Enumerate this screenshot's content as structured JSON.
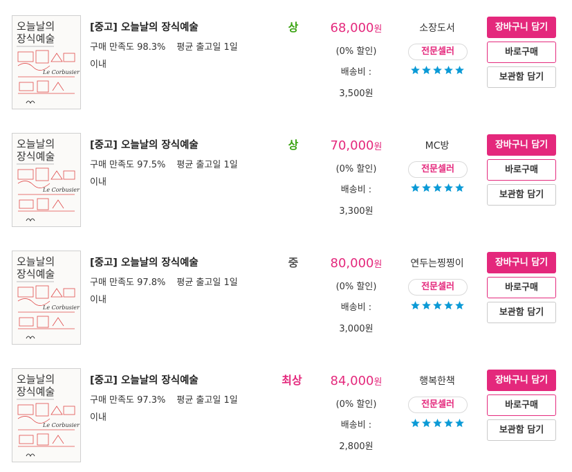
{
  "colors": {
    "accent": "#e4287c",
    "grade_good": "#3aa312",
    "grade_mid": "#555555",
    "grade_best": "#e4287c",
    "star": "#0b9ad6"
  },
  "listings": [
    {
      "title": "[중고] 오늘날의 장식예술",
      "satisfaction_label": "구매 만족도 98.3%",
      "ship_days_label": "평균 출고일 1일",
      "ship_days_suffix": "이내",
      "grade": "상",
      "grade_color": "#3aa312",
      "price": "68,000",
      "currency": "원",
      "discount": "(0% 할인)",
      "shipping_label": "배송비 :",
      "shipping_fee": "3,500원",
      "seller": "소장도서",
      "seller_badge": "전문셀러",
      "rating_stars": 5,
      "cart_button": "장바구니 담기",
      "buy_button": "바로구매",
      "save_button": "보관함 담기"
    },
    {
      "title": "[중고] 오늘날의 장식예술",
      "satisfaction_label": "구매 만족도 97.5%",
      "ship_days_label": "평균 출고일 1일",
      "ship_days_suffix": "이내",
      "grade": "상",
      "grade_color": "#3aa312",
      "price": "70,000",
      "currency": "원",
      "discount": "(0% 할인)",
      "shipping_label": "배송비 :",
      "shipping_fee": "3,300원",
      "seller": "MC방",
      "seller_badge": "전문셀러",
      "rating_stars": 5,
      "cart_button": "장바구니 담기",
      "buy_button": "바로구매",
      "save_button": "보관함 담기"
    },
    {
      "title": "[중고] 오늘날의 장식예술",
      "satisfaction_label": "구매 만족도 97.8%",
      "ship_days_label": "평균 출고일 1일",
      "ship_days_suffix": "이내",
      "grade": "중",
      "grade_color": "#555555",
      "price": "80,000",
      "currency": "원",
      "discount": "(0% 할인)",
      "shipping_label": "배송비 :",
      "shipping_fee": "3,000원",
      "seller": "연두는찡찡이",
      "seller_badge": "전문셀러",
      "rating_stars": 5,
      "cart_button": "장바구니 담기",
      "buy_button": "바로구매",
      "save_button": "보관함 담기"
    },
    {
      "title": "[중고] 오늘날의 장식예술",
      "satisfaction_label": "구매 만족도 97.3%",
      "ship_days_label": "평균 출고일 1일",
      "ship_days_suffix": "이내",
      "grade": "최상",
      "grade_color": "#e4287c",
      "price": "84,000",
      "currency": "원",
      "discount": "(0% 할인)",
      "shipping_label": "배송비 :",
      "shipping_fee": "2,800원",
      "seller": "행복한책",
      "seller_badge": "전문셀러",
      "rating_stars": 5,
      "cart_button": "장바구니 담기",
      "buy_button": "바로구매",
      "save_button": "보관함 담기"
    }
  ],
  "cover": {
    "title_line1": "오늘날의",
    "title_line2": "장식예술",
    "author": "Le Corbusier",
    "icon": "book-cover-sketch"
  }
}
